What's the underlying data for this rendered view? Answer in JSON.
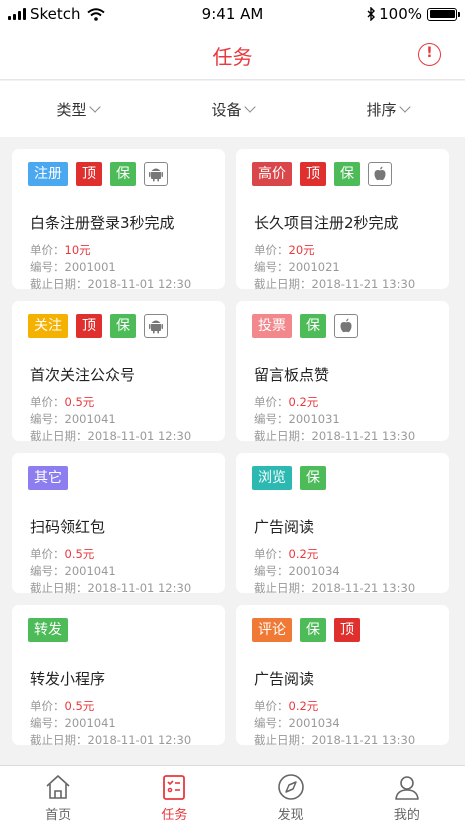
{
  "status": {
    "carrier": "Sketch",
    "time": "9:41 AM",
    "battery": "100%"
  },
  "nav": {
    "title": "任务",
    "alert_glyph": "!"
  },
  "filters": [
    {
      "label": "类型"
    },
    {
      "label": "设备"
    },
    {
      "label": "排序"
    }
  ],
  "labels": {
    "price": "单价：",
    "code": "编号：",
    "deadline": "截止日期："
  },
  "colors": {
    "accent": "#e8383d",
    "注册": "#4aa8f0",
    "顶": "#e0302e",
    "保": "#4cbb58",
    "高价": "#d9474a",
    "关注": "#f5b100",
    "投票": "#f2888b",
    "其它": "#8c7ef0",
    "浏览": "#2bb9b2",
    "转发": "#4cbb58",
    "评论": "#f07a35"
  },
  "cards": [
    {
      "tags": [
        {
          "text": "注册",
          "color": "#4aa8f0"
        },
        {
          "text": "顶",
          "color": "#e0302e"
        },
        {
          "text": "保",
          "color": "#4cbb58"
        }
      ],
      "os": "android-icon",
      "title": "白条注册登录3秒完成",
      "price": "10元",
      "code": "2001001",
      "deadline": "2018-11-01 12:30"
    },
    {
      "tags": [
        {
          "text": "高价",
          "color": "#d9474a"
        },
        {
          "text": "顶",
          "color": "#e0302e"
        },
        {
          "text": "保",
          "color": "#4cbb58"
        }
      ],
      "os": "apple-icon",
      "title": "长久项目注册2秒完成",
      "price": "20元",
      "code": "2001021",
      "deadline": "2018-11-21 13:30"
    },
    {
      "tags": [
        {
          "text": "关注",
          "color": "#f5b100"
        },
        {
          "text": "顶",
          "color": "#e0302e"
        },
        {
          "text": "保",
          "color": "#4cbb58"
        }
      ],
      "os": "android-icon",
      "title": "首次关注公众号",
      "price": "0.5元",
      "code": "2001041",
      "deadline": "2018-11-01 12:30"
    },
    {
      "tags": [
        {
          "text": "投票",
          "color": "#f2888b"
        },
        {
          "text": "保",
          "color": "#4cbb58"
        }
      ],
      "os": "apple-icon",
      "title": "留言板点赞",
      "price": "0.2元",
      "code": "2001031",
      "deadline": "2018-11-21 13:30"
    },
    {
      "tags": [
        {
          "text": "其它",
          "color": "#8c7ef0"
        }
      ],
      "os": "",
      "title": "扫码领红包",
      "price": "0.5元",
      "code": "2001041",
      "deadline": "2018-11-01 12:30"
    },
    {
      "tags": [
        {
          "text": "浏览",
          "color": "#2bb9b2"
        },
        {
          "text": "保",
          "color": "#4cbb58"
        }
      ],
      "os": "",
      "title": "广告阅读",
      "price": "0.2元",
      "code": "2001034",
      "deadline": "2018-11-21 13:30"
    },
    {
      "tags": [
        {
          "text": "转发",
          "color": "#4cbb58"
        }
      ],
      "os": "",
      "title": "转发小程序",
      "price": "0.5元",
      "code": "2001041",
      "deadline": "2018-11-01 12:30"
    },
    {
      "tags": [
        {
          "text": "评论",
          "color": "#f07a35"
        },
        {
          "text": "保",
          "color": "#4cbb58"
        },
        {
          "text": "顶",
          "color": "#e0302e"
        }
      ],
      "os": "",
      "title": "广告阅读",
      "price": "0.2元",
      "code": "2001034",
      "deadline": "2018-11-21 13:30"
    }
  ],
  "tabs": [
    {
      "label": "首页",
      "icon": "home-icon",
      "active": false
    },
    {
      "label": "任务",
      "icon": "task-list-icon",
      "active": true
    },
    {
      "label": "发现",
      "icon": "compass-icon",
      "active": false
    },
    {
      "label": "我的",
      "icon": "user-icon",
      "active": false
    }
  ]
}
